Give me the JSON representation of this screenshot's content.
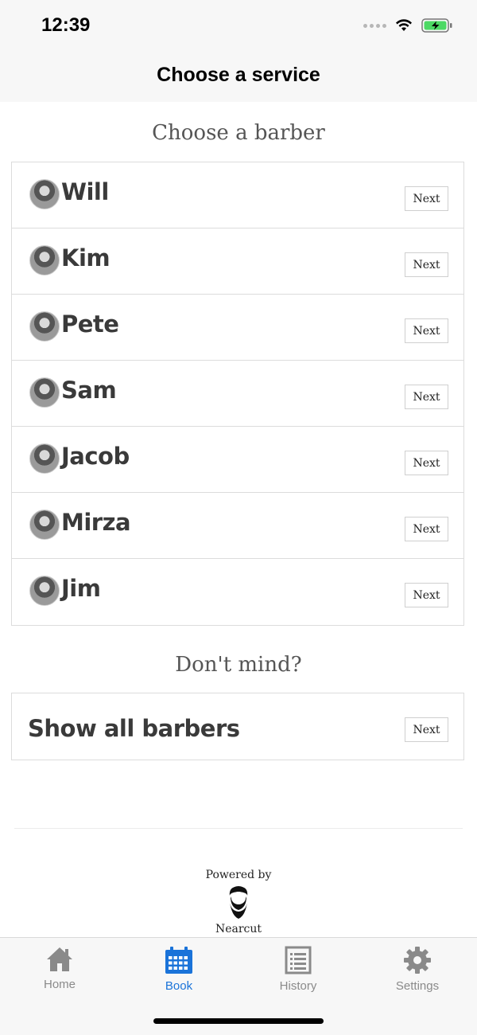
{
  "status_bar": {
    "time": "12:39"
  },
  "navbar": {
    "title": "Choose a service"
  },
  "section_barbers": {
    "title": "Choose a barber"
  },
  "barbers": [
    {
      "name": "Will",
      "next_label": "Next"
    },
    {
      "name": "Kim",
      "next_label": "Next"
    },
    {
      "name": "Pete",
      "next_label": "Next"
    },
    {
      "name": "Sam",
      "next_label": "Next"
    },
    {
      "name": "Jacob",
      "next_label": "Next"
    },
    {
      "name": "Mirza",
      "next_label": "Next"
    },
    {
      "name": "Jim",
      "next_label": "Next"
    }
  ],
  "section_any": {
    "title": "Don't mind?"
  },
  "show_all": {
    "label": "Show all barbers",
    "next_label": "Next"
  },
  "footer": {
    "powered_by": "Powered by",
    "brand": "Nearcut"
  },
  "tabs": [
    {
      "label": "Home",
      "icon": "home-icon",
      "active": false
    },
    {
      "label": "Book",
      "icon": "calendar-icon",
      "active": true
    },
    {
      "label": "History",
      "icon": "document-icon",
      "active": false
    },
    {
      "label": "Settings",
      "icon": "gear-icon",
      "active": false
    }
  ],
  "colors": {
    "accent": "#1a73d9",
    "inactive": "#8a8a8a",
    "battery": "#4cd964"
  }
}
